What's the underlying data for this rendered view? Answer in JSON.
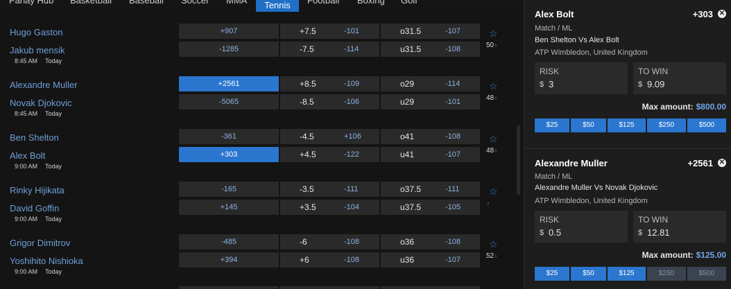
{
  "nav": {
    "tabs": [
      {
        "label": "Parlay Hub"
      },
      {
        "label": "Basketball"
      },
      {
        "label": "Baseball"
      },
      {
        "label": "Soccer"
      },
      {
        "label": "MMA"
      },
      {
        "label": "Tennis",
        "active": true
      },
      {
        "label": "Football"
      },
      {
        "label": "Boxing"
      },
      {
        "label": "Golf"
      }
    ]
  },
  "events": [
    {
      "players": [
        {
          "name": "Hugo Gaston",
          "ml": "+907",
          "spread": "+7.5",
          "spread_odds": "-101",
          "total": "o31.5",
          "total_odds": "-107"
        },
        {
          "name": "Jakub mensik",
          "ml": "-1285",
          "spread": "-7.5",
          "spread_odds": "-114",
          "total": "u31.5",
          "total_odds": "-108"
        }
      ],
      "time": "8:45 AM",
      "day": "Today",
      "more": "50"
    },
    {
      "players": [
        {
          "name": "Alexandre Muller",
          "ml": "+2561",
          "ml_selected": true,
          "spread": "+8.5",
          "spread_odds": "-109",
          "total": "o29",
          "total_odds": "-114"
        },
        {
          "name": "Novak Djokovic",
          "ml": "-5065",
          "spread": "-8.5",
          "spread_odds": "-106",
          "total": "u29",
          "total_odds": "-101"
        }
      ],
      "time": "8:45 AM",
      "day": "Today",
      "more": "48"
    },
    {
      "players": [
        {
          "name": "Ben Shelton",
          "ml": "-361",
          "spread": "-4.5",
          "spread_odds": "+106",
          "total": "o41",
          "total_odds": "-108"
        },
        {
          "name": "Alex Bolt",
          "ml": "+303",
          "ml_selected": true,
          "spread": "+4.5",
          "spread_odds": "-122",
          "total": "u41",
          "total_odds": "-107"
        }
      ],
      "time": "9:00 AM",
      "day": "Today",
      "more": "48"
    },
    {
      "players": [
        {
          "name": "Rinky Hijikata",
          "ml": "-165",
          "spread": "-3.5",
          "spread_odds": "-111",
          "total": "o37.5",
          "total_odds": "-111"
        },
        {
          "name": "David Goffin",
          "ml": "+145",
          "spread": "+3.5",
          "spread_odds": "-104",
          "total": "u37.5",
          "total_odds": "-105"
        }
      ],
      "time": "9:00 AM",
      "day": "Today",
      "more": ""
    },
    {
      "players": [
        {
          "name": "Grigor Dimitrov",
          "ml": "-485",
          "spread": "-6",
          "spread_odds": "-108",
          "total": "o36",
          "total_odds": "-108"
        },
        {
          "name": "Yoshihito Nishioka",
          "ml": "+394",
          "spread": "+6",
          "spread_odds": "-108",
          "total": "u36",
          "total_odds": "-107"
        }
      ],
      "time": "9:00 AM",
      "day": "Today",
      "more": "52"
    }
  ],
  "slip": [
    {
      "selection": "Alex Bolt",
      "odds": "+303",
      "market": "Match / ML",
      "matchup": "Ben Shelton Vs Alex Bolt",
      "league": "ATP Wimbledon, United Kingdom",
      "risk_label": "RISK",
      "risk_currency": "$",
      "risk_value": "3",
      "win_label": "TO WIN",
      "win_currency": "$",
      "win_value": "9.09",
      "max_label": "Max amount:",
      "max_value": "$800.00",
      "quick": [
        {
          "label": "$25",
          "enabled": true
        },
        {
          "label": "$50",
          "enabled": true
        },
        {
          "label": "$125",
          "enabled": true
        },
        {
          "label": "$250",
          "enabled": true
        },
        {
          "label": "$500",
          "enabled": true
        }
      ]
    },
    {
      "selection": "Alexandre Muller",
      "odds": "+2561",
      "market": "Match / ML",
      "matchup": "Alexandre Muller Vs Novak Djokovic",
      "league": "ATP Wimbledon, United Kingdom",
      "risk_label": "RISK",
      "risk_currency": "$",
      "risk_value": "0.5",
      "win_label": "TO WIN",
      "win_currency": "$",
      "win_value": "12.81",
      "max_label": "Max amount:",
      "max_value": "$125.00",
      "quick": [
        {
          "label": "$25",
          "enabled": true
        },
        {
          "label": "$50",
          "enabled": true
        },
        {
          "label": "$125",
          "enabled": true
        },
        {
          "label": "$250",
          "enabled": false
        },
        {
          "label": "$500",
          "enabled": false
        }
      ]
    }
  ],
  "icons": {
    "star": "star-icon",
    "chevron": "chevron-right-icon",
    "close": "close-icon"
  },
  "colors": {
    "accent": "#2b76cf",
    "link": "#6f9fd8",
    "odds": "#8cb3e3"
  }
}
